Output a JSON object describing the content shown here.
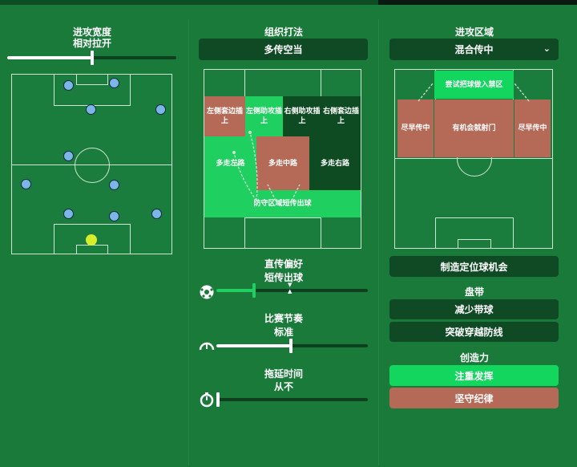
{
  "left": {
    "title": "进攻宽度",
    "value": "相对拉开",
    "width_level": 0.5
  },
  "middle": {
    "title": "组织打法",
    "style_value": "多传空当",
    "zones": {
      "left_wide": "左侧套边插上",
      "left_half": "左侧助攻插上",
      "right_half": "右侧助攻插上",
      "right_wide": "右侧套边插上",
      "left_channel": "多走左路",
      "center": "多走中路",
      "right_channel": "多走右路",
      "backline": "防守区域短传出球"
    },
    "passing_title": "直传偏好",
    "passing_value": "短传出球",
    "passing_level": 0.25,
    "tempo_title": "比赛节奏",
    "tempo_value": "标准",
    "tempo_level": 0.5,
    "timewasting_title": "拖延时间",
    "timewasting_value": "从不",
    "timewasting_level": 0.0,
    "icons": {
      "passing": "soccer-ball-icon",
      "tempo": "speedometer-icon",
      "time": "stopwatch-icon"
    }
  },
  "right": {
    "title": "进攻区域",
    "zone_value": "混合传中",
    "zones": {
      "box_top": "尝试把球做入禁区",
      "left_cross": "尽早传中",
      "center_shoot": "有机会就射门",
      "right_cross": "尽早传中"
    },
    "set_piece_button": "制造定位球机会",
    "dribble_title": "盘带",
    "dribble_1": "减少带球",
    "dribble_2": "突破穿越防线",
    "creative_title": "创造力",
    "creative_1": "注重发挥",
    "creative_2": "坚守纪律"
  },
  "colors": {
    "highlight_green": "#1fd061",
    "bright_green": "#13d65f",
    "red_zone": "#b46a57",
    "dark_box": "#0f4a24"
  }
}
